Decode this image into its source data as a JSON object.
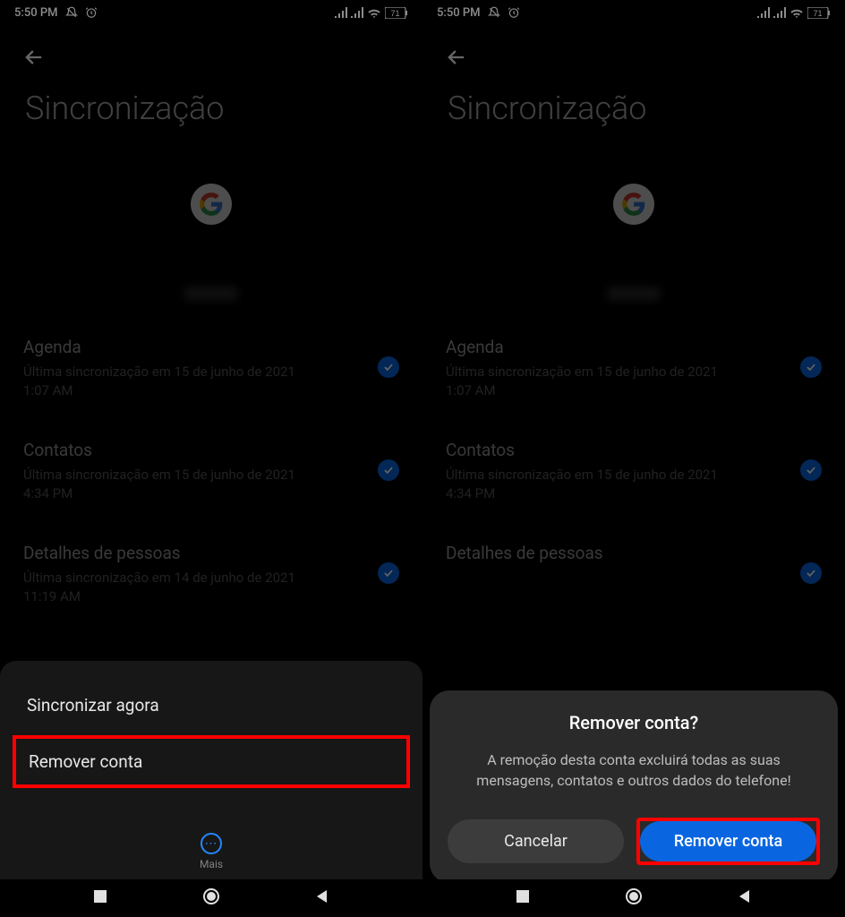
{
  "status": {
    "time": "5:50 PM",
    "battery": "71"
  },
  "page": {
    "title": "Sincronização"
  },
  "sync": {
    "items": [
      {
        "title": "Agenda",
        "sub": "Última sincronização em 15 de junho de 2021 1:07 AM"
      },
      {
        "title": "Contatos",
        "sub": "Última sincronização em 15 de junho de 2021 4:34 PM"
      },
      {
        "title": "Detalhes de pessoas",
        "sub": "Última sincronização em 14 de junho de 2021 11:19 AM"
      }
    ]
  },
  "sheet": {
    "syncNow": "Sincronizar agora",
    "remove": "Remover conta",
    "more": "Mais"
  },
  "dialog": {
    "title": "Remover conta?",
    "text": "A remoção desta conta excluirá todas as suas mensagens, contatos e outros dados do telefone!",
    "cancel": "Cancelar",
    "confirm": "Remover conta"
  }
}
